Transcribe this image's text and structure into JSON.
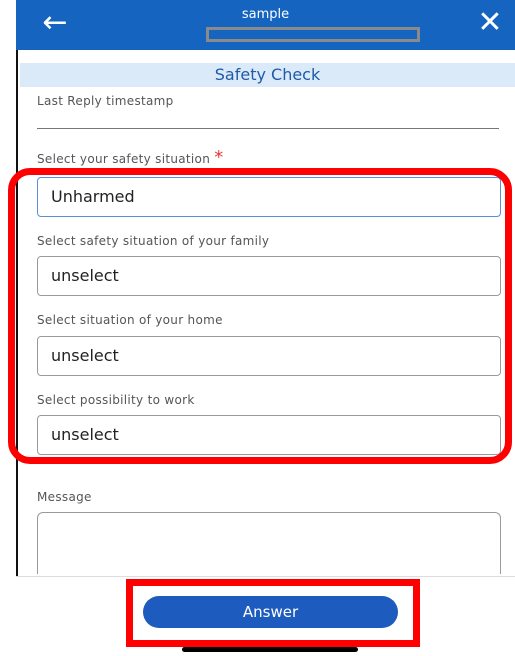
{
  "header": {
    "title": "sample",
    "back_icon": "arrow-left-icon",
    "close_icon": "close-icon",
    "back_glyph": "←",
    "close_glyph": "✕",
    "color": "#1565c0"
  },
  "section": {
    "title": "Safety Check"
  },
  "form": {
    "last_reply_label": "Last Reply timestamp",
    "safety_label": "Select your safety situation",
    "required_mark": "*",
    "safety_value": "Unharmed",
    "family_label": "Select safety situation of your family",
    "family_value": "unselect",
    "home_label": "Select situation of your home",
    "home_value": "unselect",
    "work_label": "Select possibility to work",
    "work_value": "unselect",
    "message_label": "Message",
    "message_value": ""
  },
  "footer": {
    "answer_label": "Answer"
  },
  "colors": {
    "accent": "#1e5bbf",
    "highlight": "#ff0000",
    "required": "#e53935"
  }
}
